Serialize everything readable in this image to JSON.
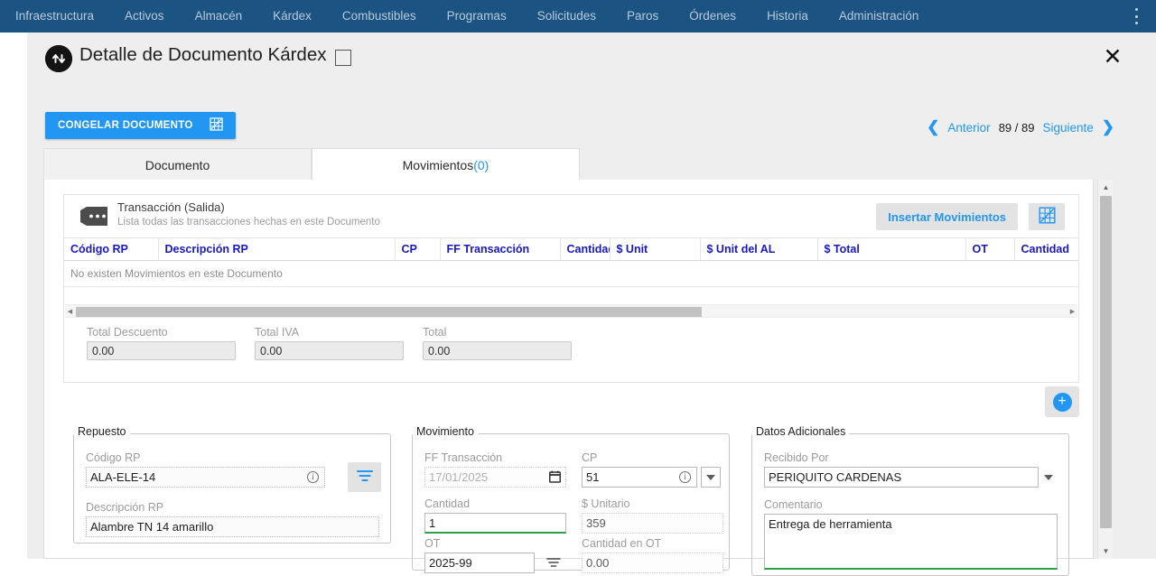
{
  "nav": {
    "items": [
      {
        "label": "Infraestructura"
      },
      {
        "label": "Activos"
      },
      {
        "label": "Almacén"
      },
      {
        "label": "Kárdex"
      },
      {
        "label": "Combustibles"
      },
      {
        "label": "Programas"
      },
      {
        "label": "Solicitudes"
      },
      {
        "label": "Paros"
      },
      {
        "label": "Órdenes"
      },
      {
        "label": "Historia"
      },
      {
        "label": "Administración"
      }
    ]
  },
  "header": {
    "title": "Detalle de Documento Kárdex",
    "freeze_button": "CONGELAR DOCUMENTO",
    "close_icon": "✕"
  },
  "pager": {
    "prev_label": "Anterior",
    "count": "89 / 89",
    "next_label": "Siguiente",
    "prev_chevron": "❮",
    "next_chevron": "❯"
  },
  "tabs": [
    {
      "label": "Documento",
      "count": "",
      "active": false
    },
    {
      "label": "Movimientos ",
      "count": "(0)",
      "active": true
    }
  ],
  "transaction": {
    "title": "Transacción (Salida)",
    "subtitle": "Lista todas las transacciones hechas en este Documento",
    "insert_button": "Insertar Movimientos",
    "export_icon": "grid-export-icon",
    "columns": [
      "Código RP",
      "Descripción RP",
      "CP",
      "FF Transacción",
      "Cantidad",
      "$ Unit",
      "$ Unit del AL",
      "$ Total",
      "OT",
      "Cantidad"
    ],
    "empty_message": "No existen Movimientos en este Documento"
  },
  "totals": [
    {
      "label": "Total Descuento",
      "value": "0.00"
    },
    {
      "label": "Total IVA",
      "value": "0.00"
    },
    {
      "label": "Total",
      "value": "0.00"
    }
  ],
  "add_button": {
    "symbol": "+"
  },
  "repuesto": {
    "legend": "Repuesto",
    "codigo_label": "Código RP",
    "codigo_value": "ALA-ELE-14",
    "descripcion_label": "Descripción RP",
    "descripcion_value": "Alambre TN 14 amarillo",
    "filter_icon": "filter-icon"
  },
  "movimiento": {
    "legend": "Movimiento",
    "ff_label": "FF Transacción",
    "ff_value": "17/01/2025",
    "cp_label": "CP",
    "cp_value": "51",
    "cantidad_label": "Cantidad",
    "cantidad_value": "1",
    "unitario_label": "$ Unitario",
    "unitario_value": "359",
    "ot_label": "OT",
    "ot_value": "2025-99",
    "cantidad_ot_label": "Cantidad en OT",
    "cantidad_ot_value": "0.00"
  },
  "datos": {
    "legend": "Datos Adicionales",
    "recibido_label": "Recibido Por",
    "recibido_value": "PERIQUITO CARDENAS",
    "comentario_label": "Comentario",
    "comentario_value": "Entrega de herramienta"
  },
  "colors": {
    "nav_bg": "#1b5383",
    "accent": "#2196f3",
    "header_text": "#1818c8",
    "valid_green": "#2e9e4f"
  }
}
